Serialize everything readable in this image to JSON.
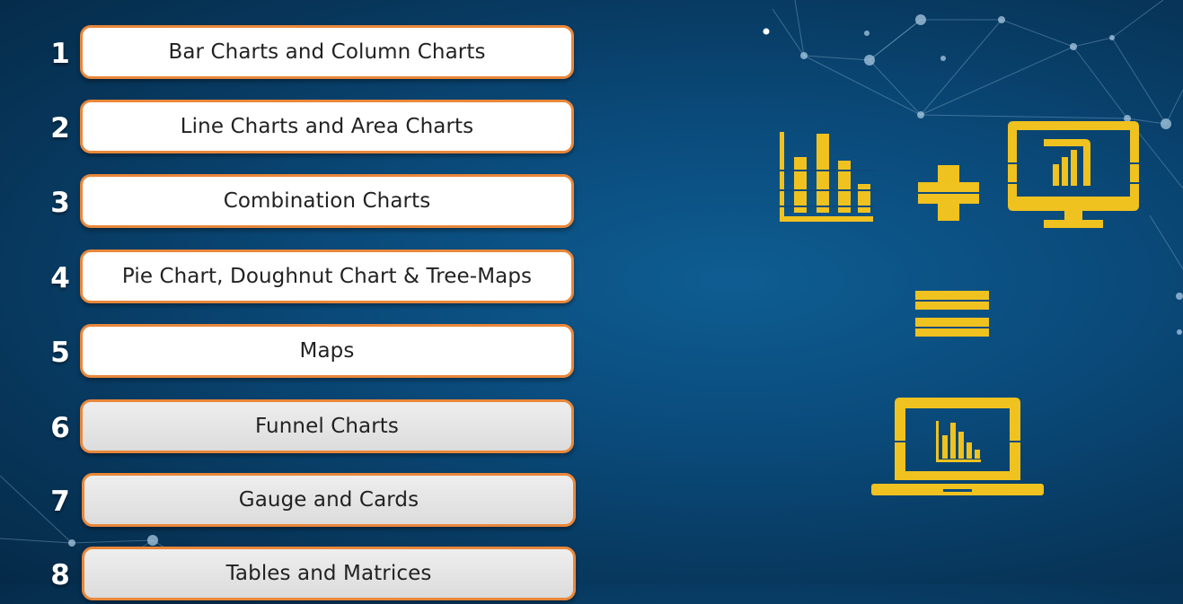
{
  "topics": [
    {
      "num": "1",
      "label": "Bar Charts and Column Charts"
    },
    {
      "num": "2",
      "label": "Line Charts and Area Charts"
    },
    {
      "num": "3",
      "label": "Combination Charts"
    },
    {
      "num": "4",
      "label": "Pie Chart, Doughnut Chart & Tree-Maps"
    },
    {
      "num": "5",
      "label": "Maps"
    },
    {
      "num": "6",
      "label": "Funnel Charts"
    },
    {
      "num": "7",
      "label": "Gauge and Cards"
    },
    {
      "num": "8",
      "label": "Tables and Matrices"
    }
  ],
  "icons": {
    "bar_chart": "bar-chart-icon",
    "plus": "plus-icon",
    "monitor": "power-bi-monitor-icon",
    "equals": "equals-icon",
    "laptop": "laptop-dashboard-icon"
  },
  "colors": {
    "accent_yellow": "#f0c21f",
    "pill_border": "#e9873a",
    "background": "#0a4a7a"
  }
}
